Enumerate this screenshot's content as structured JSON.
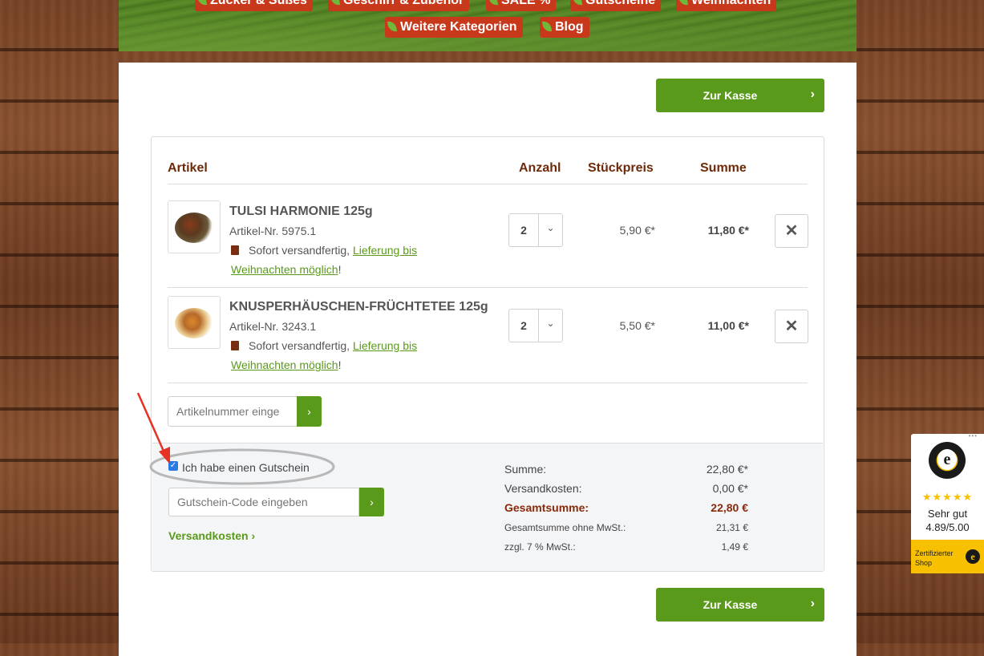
{
  "nav": {
    "top_items": [
      "Zucker & Süßes",
      "Geschirr & Zubehör",
      "SALE %",
      "Gutscheine",
      "Weihnachten"
    ],
    "items": [
      {
        "label": "Weitere Kategorien"
      },
      {
        "label": "Blog"
      }
    ]
  },
  "checkout": {
    "label": "Zur Kasse"
  },
  "cart": {
    "headers": {
      "article": "Artikel",
      "qty": "Anzahl",
      "unit_price": "Stückpreis",
      "sum": "Summe"
    },
    "items": [
      {
        "name": "TULSI HARMONIE 125g",
        "article_no": "Artikel-Nr. 5975.1",
        "ship_text": "Sofort versandfertig, ",
        "ship_link": "Lieferung bis Weihnachten möglich",
        "ship_end": "!",
        "qty": "2",
        "unit_price": "5,90 €*",
        "sum": "11,80 €*"
      },
      {
        "name": "KNUSPERHÄUSCHEN-FRÜCHTETEE 125g",
        "article_no": "Artikel-Nr. 3243.1",
        "ship_text": "Sofort versandfertig, ",
        "ship_link": "Lieferung bis Weihnachten möglich",
        "ship_end": "!",
        "qty": "2",
        "unit_price": "5,50 €*",
        "sum": "11,00 €*"
      }
    ],
    "remove_symbol": "✕",
    "article_input_placeholder": "Artikelnummer einge",
    "voucher_checkbox_label": "Ich habe einen Gutschein",
    "voucher_input_placeholder": "Gutschein-Code eingeben",
    "shipping_link": "Versandkosten ›"
  },
  "totals": {
    "subtotal_label": "Summe:",
    "subtotal": "22,80 €*",
    "shipping_label": "Versandkosten:",
    "shipping": "0,00 €*",
    "grand_label": "Gesamtsumme:",
    "grand": "22,80 €",
    "net_label": "Gesamtsumme ohne MwSt.:",
    "net": "21,31 €",
    "vat_label": "zzgl. 7 % MwSt.:",
    "vat": "1,49 €"
  },
  "trusted_shops": {
    "stars": "★★★★★",
    "rating_text": "Sehr gut",
    "score": "4.89/5.00",
    "certified": "Zertifizierter Shop",
    "dots": "•••"
  },
  "colors": {
    "green": "#5a9a1a",
    "brown": "#6e2a08",
    "red_nav": "#c8391c",
    "annotation": "#e53222"
  }
}
